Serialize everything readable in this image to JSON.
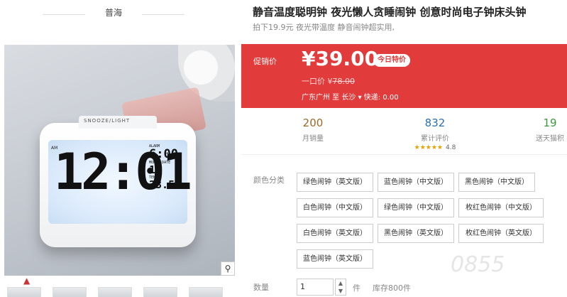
{
  "brand": "普海",
  "photo": {
    "clock_time": "12:01",
    "am": "AM",
    "alarm_label": "ALARM",
    "alarm_time": "6:00",
    "date_label": "MONTH  DATE",
    "date_value": "11",
    "temp_label": "TEMP",
    "temp_value": "23.5",
    "button_text": "SNOOZE/LIGHT"
  },
  "zoom_icon": "search-icon",
  "product": {
    "title": "静音温度聪明钟 夜光懒人贪睡闹钟 创意时尚电子钟床头钟",
    "subtitle": "拍下19.9元 夜光带温度 静音闹钟超实用,"
  },
  "price": {
    "label": "促销价",
    "current": "¥39.00",
    "badge": "今日特价",
    "orig_label": "一口价 ¥",
    "orig_value": "78.00",
    "ship_from": "广东广州 至",
    "ship_to": "长沙",
    "ship_fee": "快递: 0.00",
    "band_color": "#e13b3b"
  },
  "stats": [
    {
      "num": "200",
      "label": "月销量",
      "color": "#9a6a2a"
    },
    {
      "num": "832",
      "label": "累计评价",
      "stars": "★★★★★",
      "rating": "4.8",
      "color": "#2a6fb5"
    },
    {
      "num": "19",
      "label": "送天猫积",
      "color": "#3a9a3a"
    }
  ],
  "options": {
    "label": "颜色分类",
    "items": [
      "绿色闹钟（英文版）",
      "蓝色闹钟（中文版）",
      "黑色闹钟（中文版）",
      "白色闹钟（中文版）",
      "绿色闹钟（中文版）",
      "枚红色闹钟（中文版）",
      "白色闹钟（英文版）",
      "黑色闹钟（英文版）",
      "枚红色闹钟（英文版）",
      "蓝色闹钟（英文版）"
    ]
  },
  "quantity": {
    "label": "数量",
    "value": "1",
    "unit": "件",
    "stock": "库存800件"
  },
  "watermark": "0855"
}
